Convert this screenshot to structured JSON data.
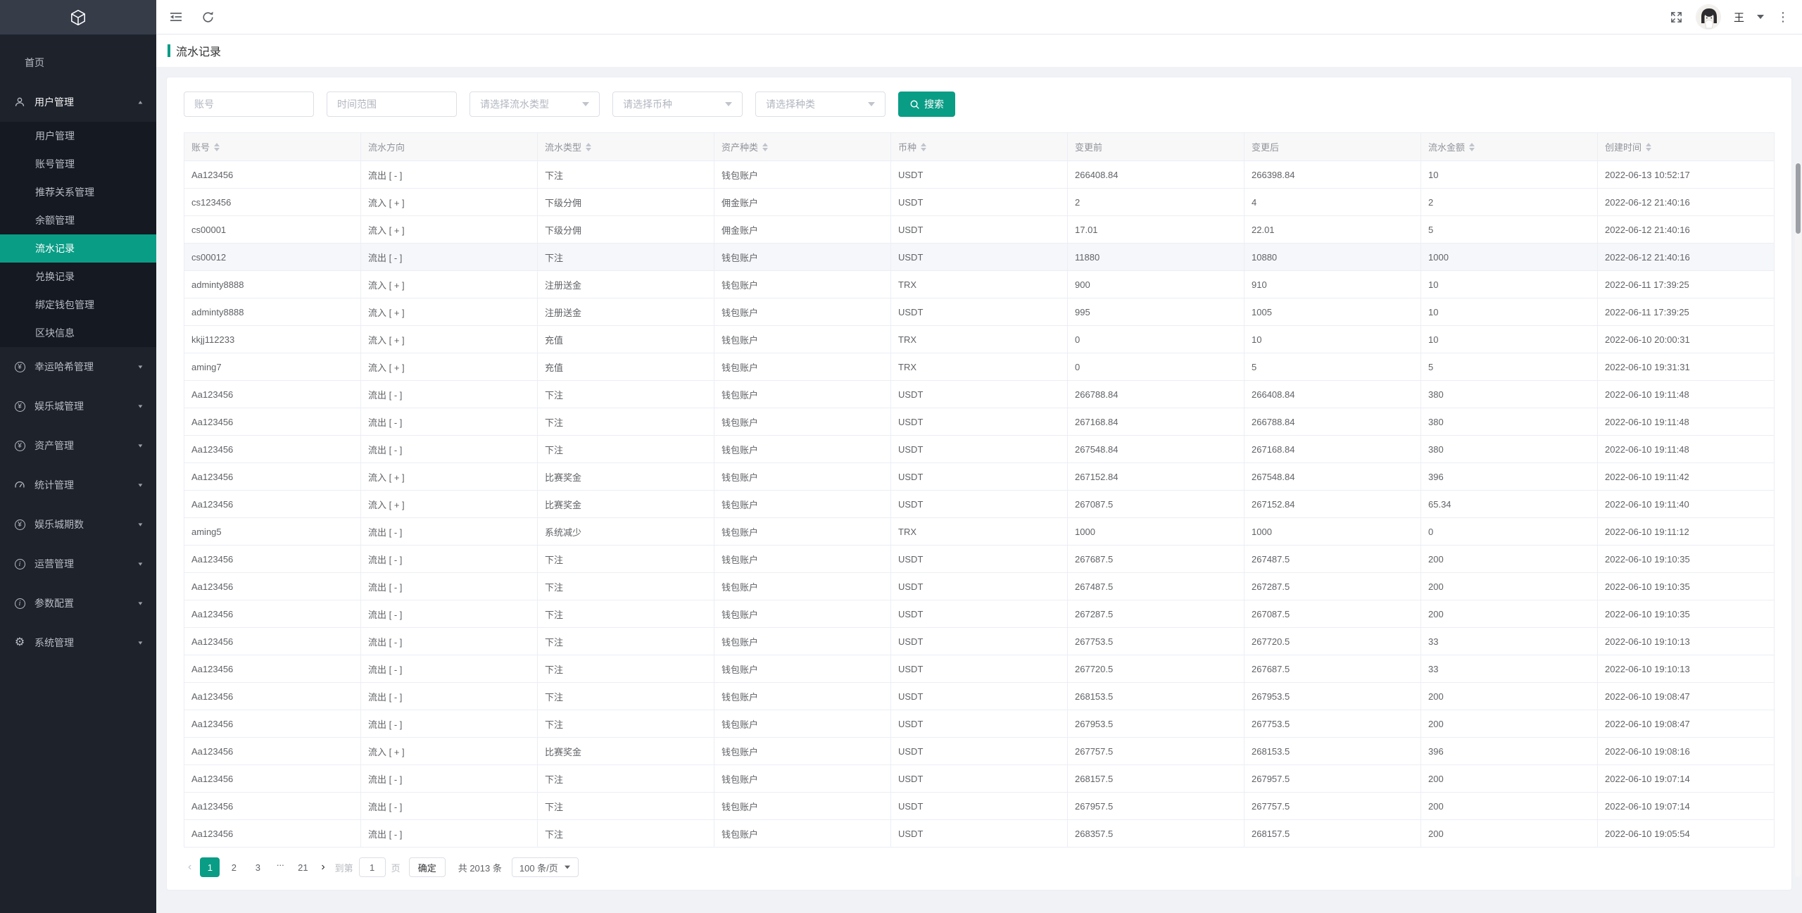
{
  "colors": {
    "accent": "#0a9d86",
    "sidebar_bg": "#1e222b",
    "submenu_bg": "#151922",
    "logo_bg": "#363d49"
  },
  "topbar": {
    "username": "王"
  },
  "page": {
    "title": "流水记录"
  },
  "sidebar": {
    "items": [
      {
        "key": "home",
        "label": "首页",
        "icon": null
      },
      {
        "key": "user-management",
        "label": "用户管理",
        "icon": "user-icon",
        "expanded": true,
        "children": [
          {
            "key": "user-management-sub",
            "label": "用户管理"
          },
          {
            "key": "account-management",
            "label": "账号管理"
          },
          {
            "key": "referral-management",
            "label": "推荐关系管理"
          },
          {
            "key": "balance-management",
            "label": "余额管理"
          },
          {
            "key": "flow-records",
            "label": "流水记录",
            "active": true
          },
          {
            "key": "exchange-records",
            "label": "兑换记录"
          },
          {
            "key": "wallet-binding",
            "label": "绑定钱包管理"
          },
          {
            "key": "block-info",
            "label": "区块信息"
          }
        ]
      },
      {
        "key": "lucky-hash-management",
        "label": "幸运哈希管理",
        "icon": "yen-circle-icon"
      },
      {
        "key": "casino-management",
        "label": "娱乐城管理",
        "icon": "yen-circle-icon"
      },
      {
        "key": "asset-management",
        "label": "资产管理",
        "icon": "yen-circle-icon"
      },
      {
        "key": "statistics-management",
        "label": "统计管理",
        "icon": "gauge-icon"
      },
      {
        "key": "casino-periods",
        "label": "娱乐城期数",
        "icon": "yen-circle-icon"
      },
      {
        "key": "operations-management",
        "label": "运营管理",
        "icon": "info-circle-icon"
      },
      {
        "key": "parameter-config",
        "label": "参数配置",
        "icon": "info-circle-icon"
      },
      {
        "key": "system-management",
        "label": "系统管理",
        "icon": "gear-icon"
      }
    ]
  },
  "filters": {
    "account_placeholder": "账号",
    "time_range_placeholder": "时间范围",
    "flow_type_placeholder": "请选择流水类型",
    "currency_placeholder": "请选择币种",
    "category_placeholder": "请选择种类",
    "search_label": "搜索"
  },
  "table": {
    "columns": [
      {
        "key": "account",
        "label": "账号",
        "sortable": true
      },
      {
        "key": "direction",
        "label": "流水方向",
        "sortable": false
      },
      {
        "key": "flow-type",
        "label": "流水类型",
        "sortable": true
      },
      {
        "key": "asset-type",
        "label": "资产种类",
        "sortable": true
      },
      {
        "key": "currency",
        "label": "币种",
        "sortable": true
      },
      {
        "key": "before",
        "label": "变更前",
        "sortable": false
      },
      {
        "key": "after",
        "label": "变更后",
        "sortable": false
      },
      {
        "key": "amount",
        "label": "流水金额",
        "sortable": true
      },
      {
        "key": "created-at",
        "label": "创建时间",
        "sortable": true
      }
    ],
    "hovered_row_index": 3,
    "rows": [
      [
        "Aa123456",
        "流出 [ - ]",
        "下注",
        "钱包账户",
        "USDT",
        "266408.84",
        "266398.84",
        "10",
        "2022-06-13 10:52:17"
      ],
      [
        "cs123456",
        "流入 [ + ]",
        "下级分佣",
        "佣金账户",
        "USDT",
        "2",
        "4",
        "2",
        "2022-06-12 21:40:16"
      ],
      [
        "cs00001",
        "流入 [ + ]",
        "下级分佣",
        "佣金账户",
        "USDT",
        "17.01",
        "22.01",
        "5",
        "2022-06-12 21:40:16"
      ],
      [
        "cs00012",
        "流出 [ - ]",
        "下注",
        "钱包账户",
        "USDT",
        "11880",
        "10880",
        "1000",
        "2022-06-12 21:40:16"
      ],
      [
        "adminty8888",
        "流入 [ + ]",
        "注册送金",
        "钱包账户",
        "TRX",
        "900",
        "910",
        "10",
        "2022-06-11 17:39:25"
      ],
      [
        "adminty8888",
        "流入 [ + ]",
        "注册送金",
        "钱包账户",
        "USDT",
        "995",
        "1005",
        "10",
        "2022-06-11 17:39:25"
      ],
      [
        "kkjj112233",
        "流入 [ + ]",
        "充值",
        "钱包账户",
        "TRX",
        "0",
        "10",
        "10",
        "2022-06-10 20:00:31"
      ],
      [
        "aming7",
        "流入 [ + ]",
        "充值",
        "钱包账户",
        "TRX",
        "0",
        "5",
        "5",
        "2022-06-10 19:31:31"
      ],
      [
        "Aa123456",
        "流出 [ - ]",
        "下注",
        "钱包账户",
        "USDT",
        "266788.84",
        "266408.84",
        "380",
        "2022-06-10 19:11:48"
      ],
      [
        "Aa123456",
        "流出 [ - ]",
        "下注",
        "钱包账户",
        "USDT",
        "267168.84",
        "266788.84",
        "380",
        "2022-06-10 19:11:48"
      ],
      [
        "Aa123456",
        "流出 [ - ]",
        "下注",
        "钱包账户",
        "USDT",
        "267548.84",
        "267168.84",
        "380",
        "2022-06-10 19:11:48"
      ],
      [
        "Aa123456",
        "流入 [ + ]",
        "比赛奖金",
        "钱包账户",
        "USDT",
        "267152.84",
        "267548.84",
        "396",
        "2022-06-10 19:11:42"
      ],
      [
        "Aa123456",
        "流入 [ + ]",
        "比赛奖金",
        "钱包账户",
        "USDT",
        "267087.5",
        "267152.84",
        "65.34",
        "2022-06-10 19:11:40"
      ],
      [
        "aming5",
        "流出 [ - ]",
        "系统减少",
        "钱包账户",
        "TRX",
        "1000",
        "1000",
        "0",
        "2022-06-10 19:11:12"
      ],
      [
        "Aa123456",
        "流出 [ - ]",
        "下注",
        "钱包账户",
        "USDT",
        "267687.5",
        "267487.5",
        "200",
        "2022-06-10 19:10:35"
      ],
      [
        "Aa123456",
        "流出 [ - ]",
        "下注",
        "钱包账户",
        "USDT",
        "267487.5",
        "267287.5",
        "200",
        "2022-06-10 19:10:35"
      ],
      [
        "Aa123456",
        "流出 [ - ]",
        "下注",
        "钱包账户",
        "USDT",
        "267287.5",
        "267087.5",
        "200",
        "2022-06-10 19:10:35"
      ],
      [
        "Aa123456",
        "流出 [ - ]",
        "下注",
        "钱包账户",
        "USDT",
        "267753.5",
        "267720.5",
        "33",
        "2022-06-10 19:10:13"
      ],
      [
        "Aa123456",
        "流出 [ - ]",
        "下注",
        "钱包账户",
        "USDT",
        "267720.5",
        "267687.5",
        "33",
        "2022-06-10 19:10:13"
      ],
      [
        "Aa123456",
        "流出 [ - ]",
        "下注",
        "钱包账户",
        "USDT",
        "268153.5",
        "267953.5",
        "200",
        "2022-06-10 19:08:47"
      ],
      [
        "Aa123456",
        "流出 [ - ]",
        "下注",
        "钱包账户",
        "USDT",
        "267953.5",
        "267753.5",
        "200",
        "2022-06-10 19:08:47"
      ],
      [
        "Aa123456",
        "流入 [ + ]",
        "比赛奖金",
        "钱包账户",
        "USDT",
        "267757.5",
        "268153.5",
        "396",
        "2022-06-10 19:08:16"
      ],
      [
        "Aa123456",
        "流出 [ - ]",
        "下注",
        "钱包账户",
        "USDT",
        "268157.5",
        "267957.5",
        "200",
        "2022-06-10 19:07:14"
      ],
      [
        "Aa123456",
        "流出 [ - ]",
        "下注",
        "钱包账户",
        "USDT",
        "267957.5",
        "267757.5",
        "200",
        "2022-06-10 19:07:14"
      ],
      [
        "Aa123456",
        "流出 [ - ]",
        "下注",
        "钱包账户",
        "USDT",
        "268357.5",
        "268157.5",
        "200",
        "2022-06-10 19:05:54"
      ]
    ]
  },
  "pagination": {
    "prev_icon": "‹",
    "next_icon": "›",
    "pages": [
      "1",
      "2",
      "3",
      "...",
      "21"
    ],
    "active_page": "1",
    "jump_prefix": "到第",
    "jump_value": "1",
    "jump_suffix": "页",
    "confirm_label": "确定",
    "total_label": "共 2013 条",
    "page_size": "100 条/页"
  }
}
